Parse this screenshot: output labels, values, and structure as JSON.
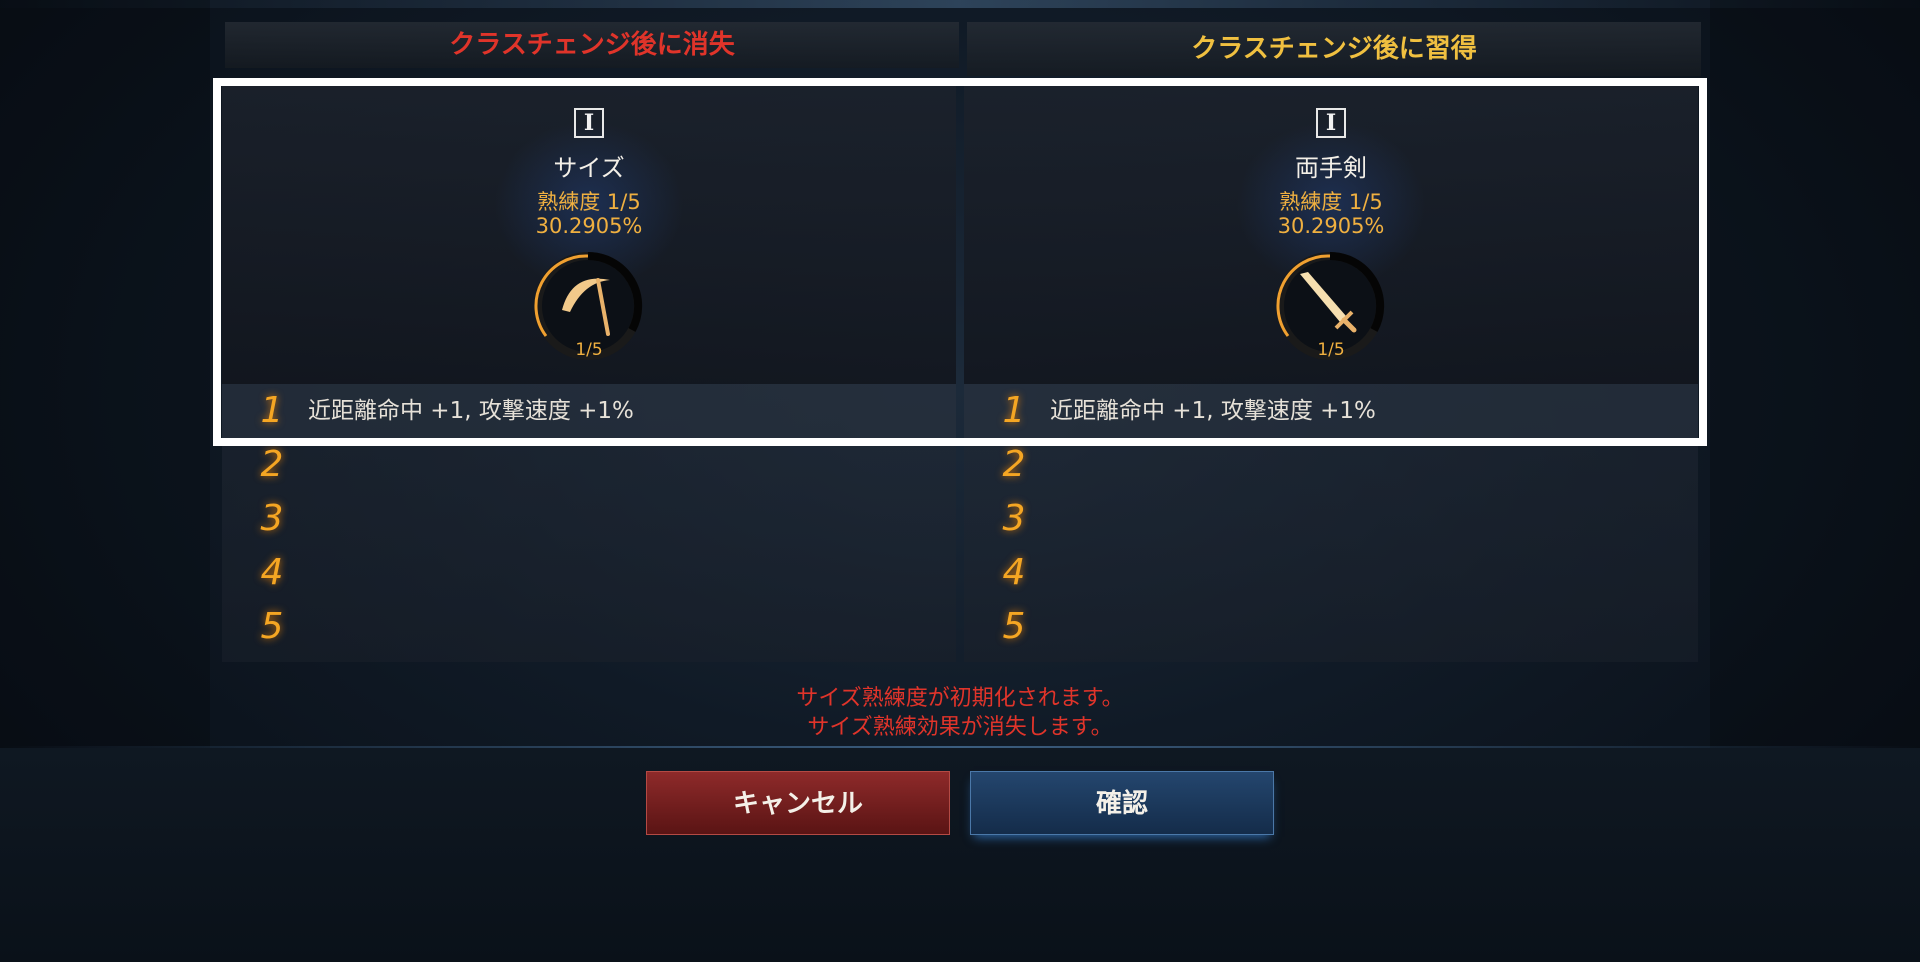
{
  "left_column": {
    "header": "クラスチェンジ後に消失",
    "tier": "I",
    "weapon_name": "サイズ",
    "proficiency_level": "熟練度 1/5",
    "proficiency_percent": "30.2905%",
    "ring_label": "1/5",
    "weapon_icon": "scythe-icon",
    "effects": [
      {
        "num": "1",
        "text": "近距離命中 +1, 攻撃速度 +1%"
      },
      {
        "num": "2",
        "text": ""
      },
      {
        "num": "3",
        "text": ""
      },
      {
        "num": "4",
        "text": ""
      },
      {
        "num": "5",
        "text": ""
      }
    ]
  },
  "right_column": {
    "header": "クラスチェンジ後に習得",
    "tier": "I",
    "weapon_name": "両手剣",
    "proficiency_level": "熟練度 1/5",
    "proficiency_percent": "30.2905%",
    "ring_label": "1/5",
    "weapon_icon": "sword-icon",
    "effects": [
      {
        "num": "1",
        "text": "近距離命中 +1, 攻撃速度 +1%"
      },
      {
        "num": "2",
        "text": ""
      },
      {
        "num": "3",
        "text": ""
      },
      {
        "num": "4",
        "text": ""
      },
      {
        "num": "5",
        "text": ""
      }
    ]
  },
  "warnings": [
    "サイズ熟練度が初期化されます。",
    "サイズ熟練効果が消失します。"
  ],
  "buttons": {
    "cancel": "キャンセル",
    "confirm": "確認"
  },
  "colors": {
    "loss_red": "#e0342a",
    "gain_gold": "#f0c040",
    "proficiency_orange": "#f0b040"
  }
}
